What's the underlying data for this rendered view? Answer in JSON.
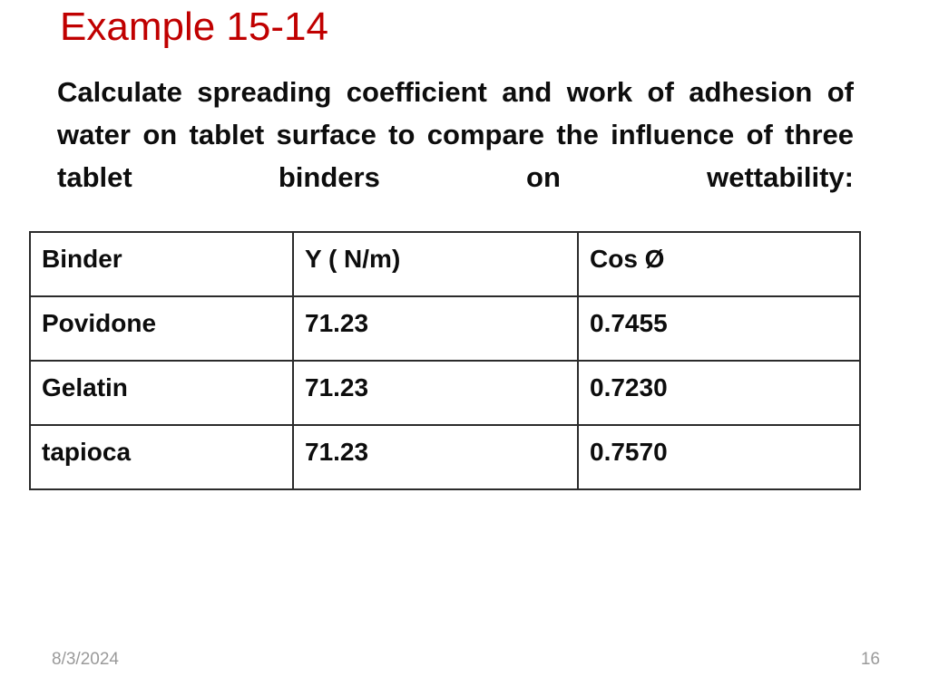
{
  "slide": {
    "title": "Example 15-14",
    "title_color": "#C00000",
    "body_text": "Calculate spreading coefficient and work of adhesion of water on tablet surface  to compare the influence of three tablet binders on wettability:",
    "body_color": "#0D0D0D"
  },
  "table": {
    "headers": [
      "Binder",
      "Y ( N/m)",
      "Cos Ø"
    ],
    "rows": [
      {
        "binder": "Povidone",
        "gamma": "71.23",
        "cos": "0.7455"
      },
      {
        "binder": "Gelatin",
        "gamma": "71.23",
        "cos": "0.7230"
      },
      {
        "binder": "tapioca",
        "gamma": "71.23",
        "cos": "0.7570"
      }
    ],
    "border_color": "#2B2B2B"
  },
  "footer": {
    "date": "8/3/2024",
    "page_number": "16",
    "text_color": "#9A9A9A"
  }
}
